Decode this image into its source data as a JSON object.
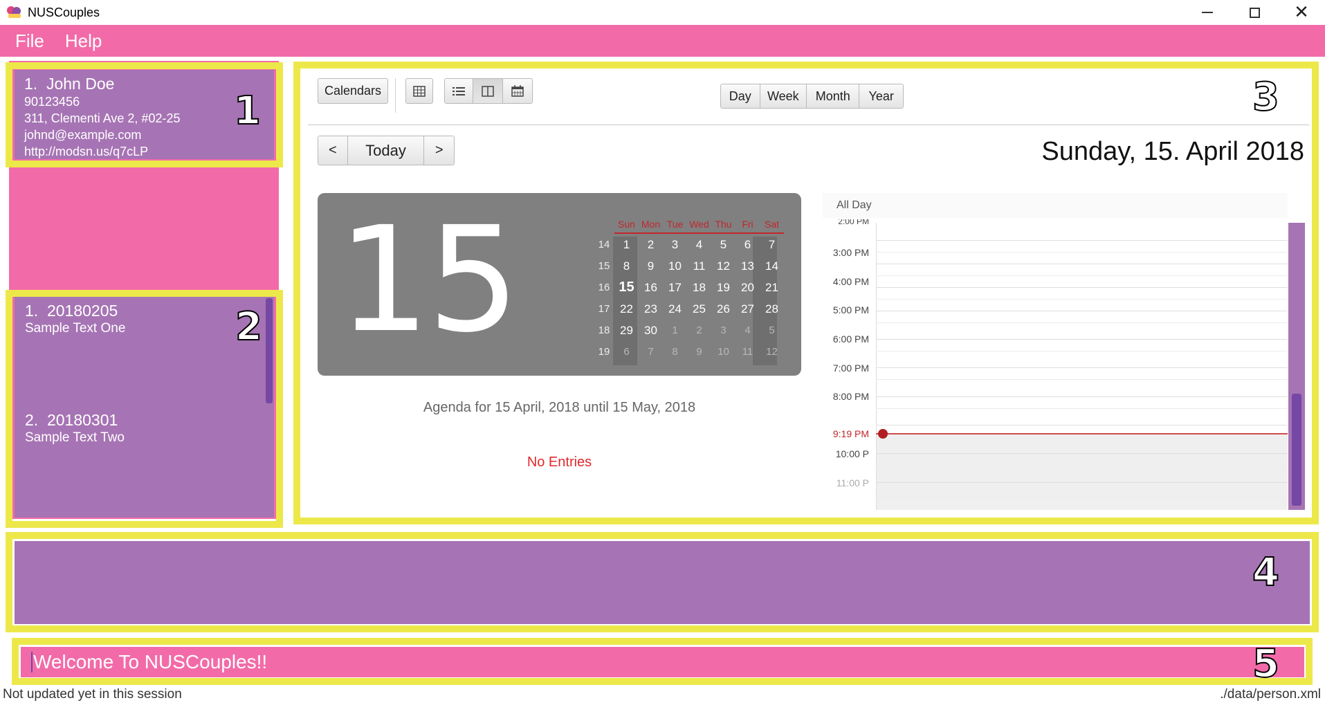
{
  "window": {
    "title": "NUSCouples",
    "controls": {
      "minimize": "minimize-icon",
      "maximize": "maximize-icon",
      "close": "close-icon"
    }
  },
  "menu": {
    "items": [
      "File",
      "Help"
    ]
  },
  "annotations": [
    "1",
    "2",
    "3",
    "4",
    "5"
  ],
  "persons": [
    {
      "index": "1.",
      "name": "John Doe",
      "phone": "90123456",
      "address": "311, Clementi Ave 2, #02-25",
      "email": "johnd@example.com",
      "url": "http://modsn.us/q7cLP"
    }
  ],
  "notes": [
    {
      "index": "1.",
      "date": "20180205",
      "text": "Sample Text One"
    },
    {
      "index": "2.",
      "date": "20180301",
      "text": "Sample Text Two"
    }
  ],
  "calendar": {
    "calendars_button": "Calendars",
    "view_icons": [
      "table-icon",
      "list-icon",
      "split-view-icon",
      "calendar-icon"
    ],
    "range_buttons": [
      "Day",
      "Week",
      "Month",
      "Year"
    ],
    "nav": {
      "prev": "<",
      "today": "Today",
      "next": ">"
    },
    "date_header": "Sunday, 15. April 2018",
    "big_day": "15",
    "weekdays": [
      "Sun",
      "Mon",
      "Tue",
      "Wed",
      "Thu",
      "Fri",
      "Sat"
    ],
    "weeks": [
      {
        "week": "14",
        "days": [
          "1",
          "2",
          "3",
          "4",
          "5",
          "6",
          "7"
        ]
      },
      {
        "week": "15",
        "days": [
          "8",
          "9",
          "10",
          "11",
          "12",
          "13",
          "14"
        ]
      },
      {
        "week": "16",
        "days": [
          "15",
          "16",
          "17",
          "18",
          "19",
          "20",
          "21"
        ]
      },
      {
        "week": "17",
        "days": [
          "22",
          "23",
          "24",
          "25",
          "26",
          "27",
          "28"
        ]
      },
      {
        "week": "18",
        "days": [
          "29",
          "30",
          "1",
          "2",
          "3",
          "4",
          "5"
        ]
      },
      {
        "week": "19",
        "days": [
          "6",
          "7",
          "8",
          "9",
          "10",
          "11",
          "12"
        ]
      }
    ],
    "today_value": "15",
    "agenda_title": "Agenda for 15 April, 2018 until 15 May, 2018",
    "no_entries": "No Entries",
    "all_day_label": "All Day",
    "time_labels": [
      "2:00 PM",
      "3:00 PM",
      "4:00 PM",
      "5:00 PM",
      "6:00 PM",
      "7:00 PM",
      "8:00 PM",
      "10:00 P",
      "11:00 P"
    ],
    "current_time": "9:19 PM"
  },
  "result": {
    "text": ""
  },
  "command": {
    "value": "Welcome To NUSCouples!!"
  },
  "status": {
    "left": "Not updated yet in this session",
    "right": "./data/person.xml"
  },
  "colors": {
    "pink": "#f26ba8",
    "purple": "#a674b4",
    "dark_purple": "#7648a5",
    "highlight": "#ede84a",
    "red": "#c0272d"
  }
}
